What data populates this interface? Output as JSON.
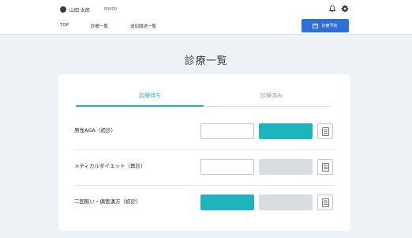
{
  "header": {
    "user_name": "山田 太郎",
    "user_suffix": "",
    "member_label": "",
    "member_no": "00000",
    "nav": [
      "TOP",
      "診療一覧",
      "追加闘述一覧"
    ],
    "reserve_label": "診療予約"
  },
  "page": {
    "title": "診療一覧"
  },
  "tabs": {
    "active": "診療待ち",
    "inactive": "診療済み"
  },
  "rows": [
    {
      "date": "",
      "title": "男性AGA（初診）",
      "note": "",
      "btn1": "",
      "btn2": "",
      "btn2_state": "teal",
      "btn1_state": "outline"
    },
    {
      "date": "",
      "title": "メディカルダイエット（再診）",
      "note": "",
      "btn1": "",
      "btn2": "",
      "btn2_state": "grey",
      "btn1_state": "outline"
    },
    {
      "date": "",
      "title": "二回飲い・偶管漢方（初診）",
      "note": "",
      "btn1": "",
      "btn2": "",
      "btn2_state": "grey",
      "btn1_state": "teal"
    }
  ],
  "colors": {
    "accent": "#1eb3bd",
    "primary": "#2f6fd8",
    "disabled": "#d9dde1"
  },
  "icons": {
    "user": "avatar-icon",
    "bell": "bell-icon",
    "settings": "gear-icon",
    "calendar": "calendar-icon",
    "document": "document-icon"
  }
}
